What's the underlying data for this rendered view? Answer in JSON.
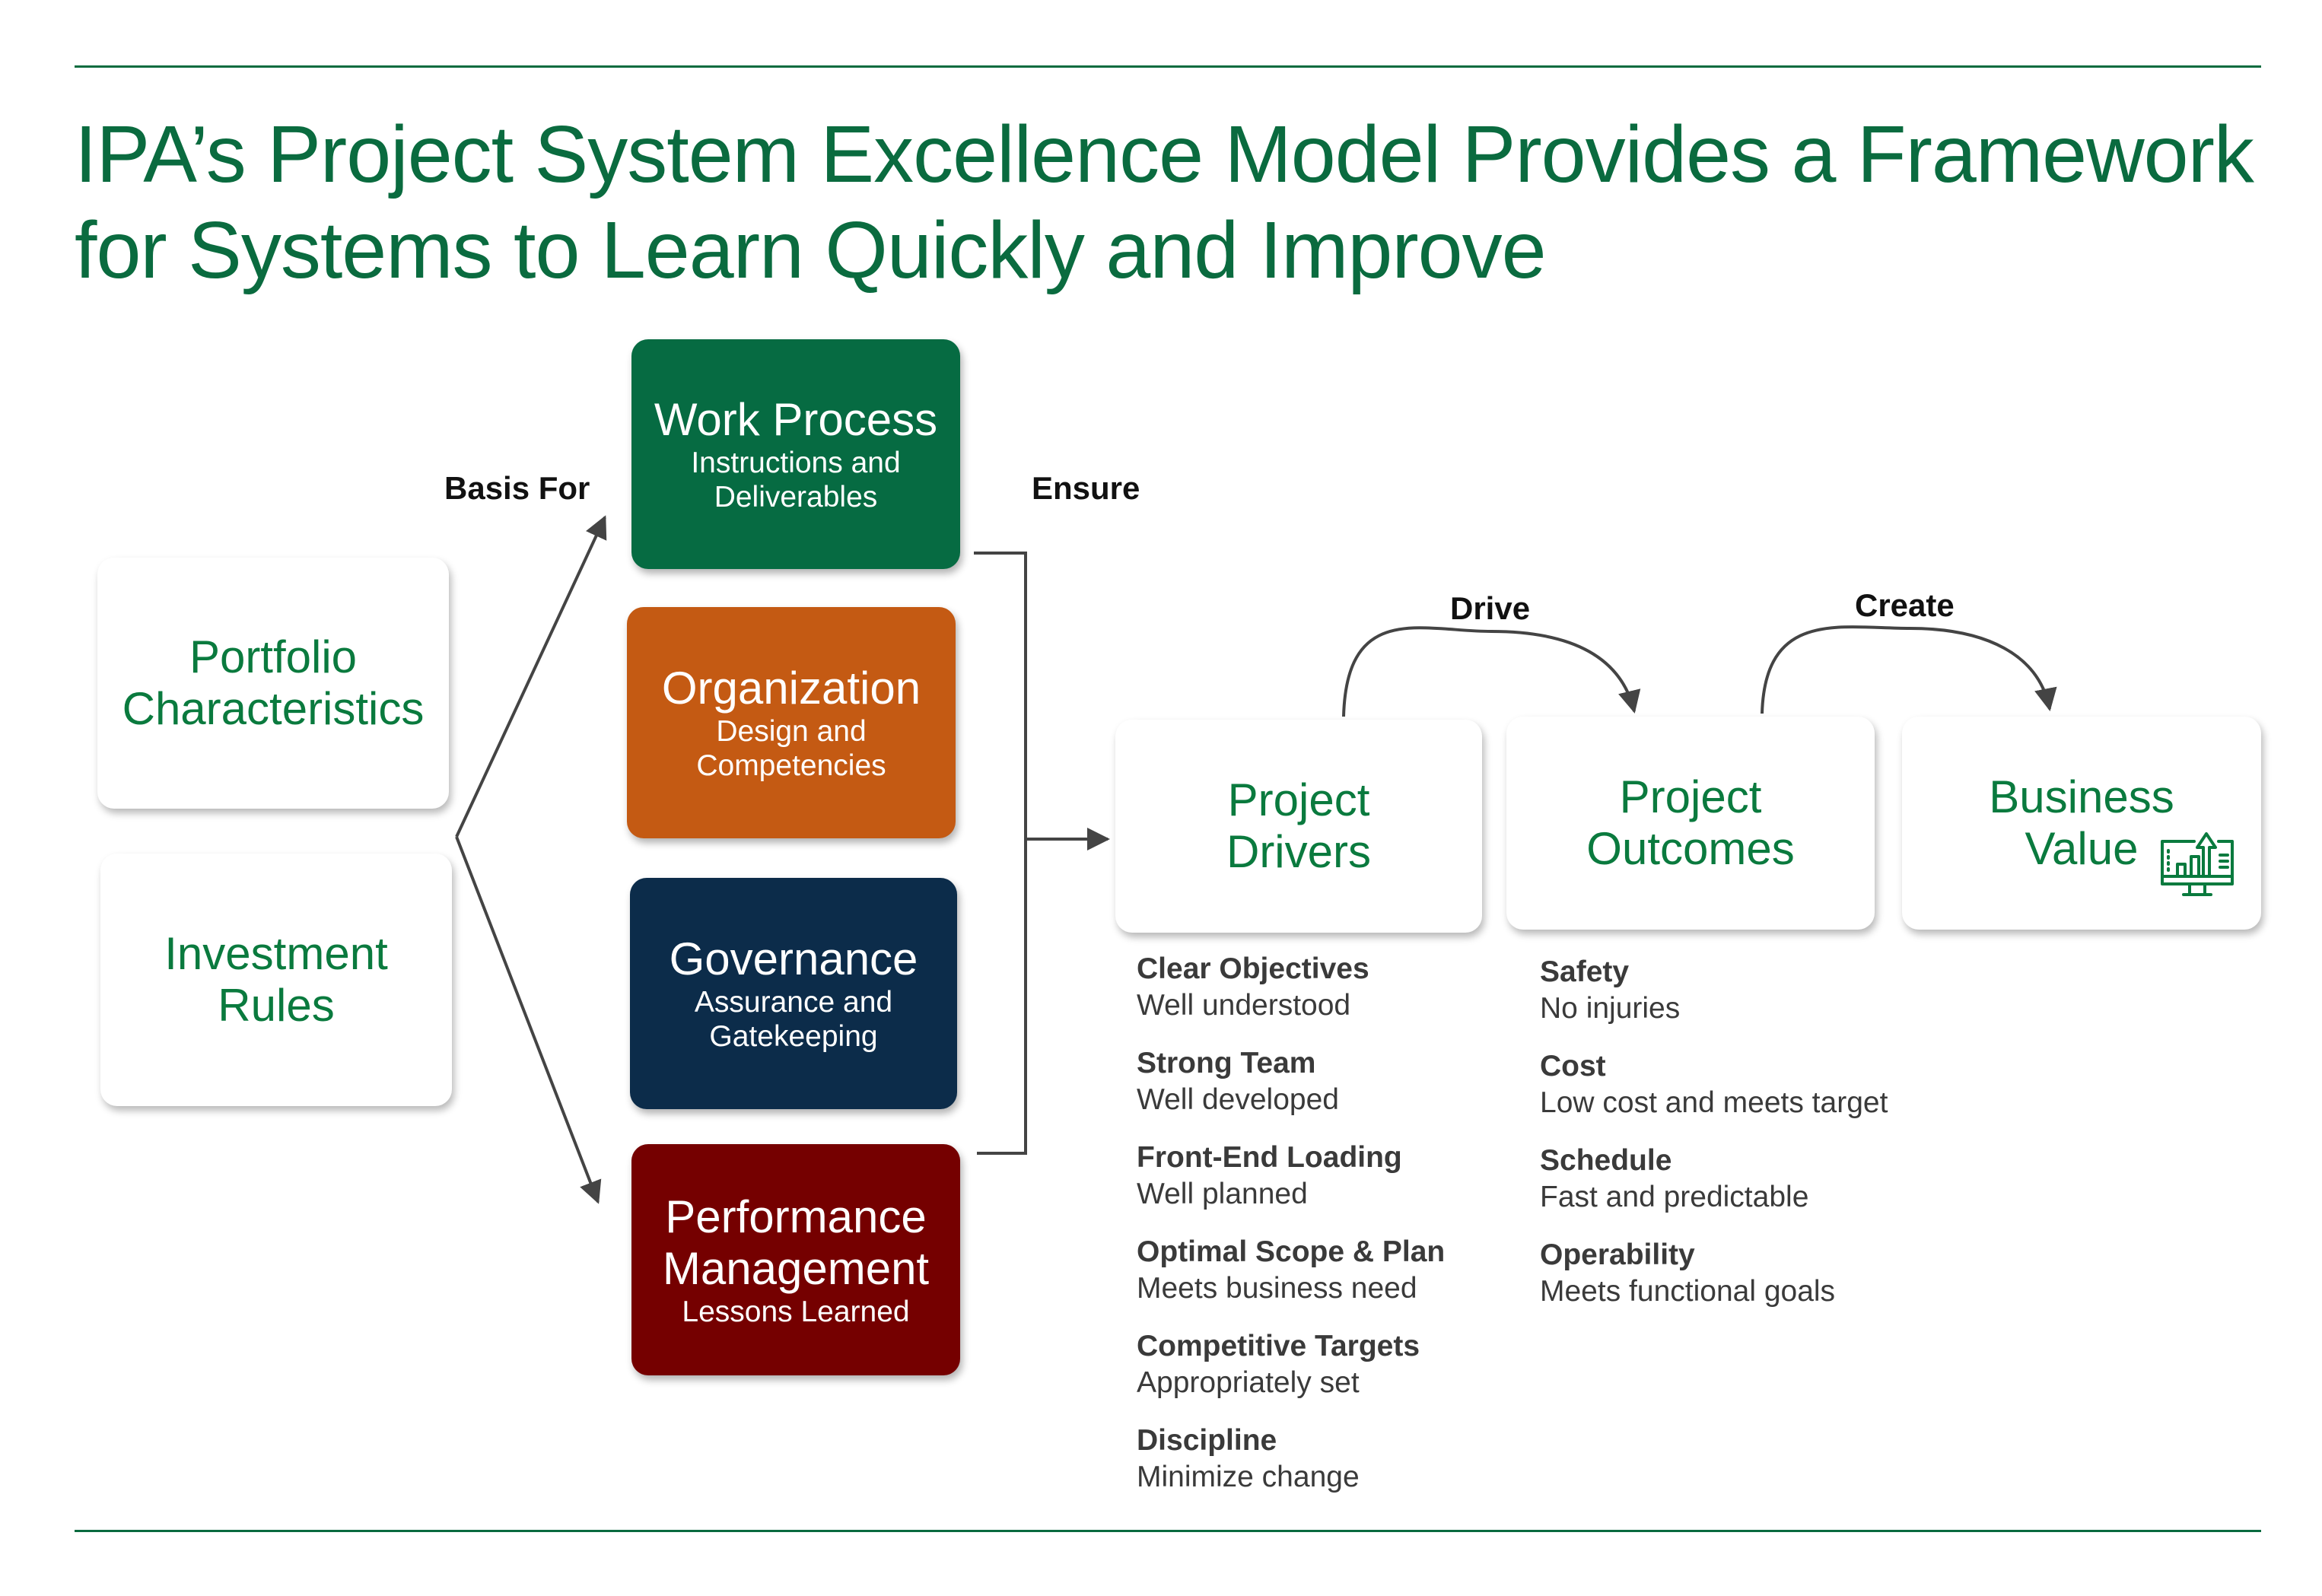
{
  "title": "IPA’s Project System Excellence Model Provides a Framework for Systems to Learn Quickly and Improve",
  "colors": {
    "brand_green": "#0a6b3f",
    "work_process": "#066b42",
    "organization": "#c45a13",
    "governance": "#0c2c4a",
    "performance": "#750000",
    "connector": "#444444"
  },
  "inputs": [
    {
      "label": "Portfolio Characteristics"
    },
    {
      "label": "Investment Rules"
    }
  ],
  "connector_labels": {
    "basis_for": "Basis For",
    "ensure": "Ensure",
    "drive": "Drive",
    "create": "Create"
  },
  "system_boxes": [
    {
      "title": "Work Process",
      "subtitle": "Instructions and Deliverables"
    },
    {
      "title": "Organization",
      "subtitle": "Design and Competencies"
    },
    {
      "title": "Governance",
      "subtitle": "Assurance and Gatekeeping"
    },
    {
      "title": "Performance Management",
      "subtitle": "Lessons Learned"
    }
  ],
  "stages": [
    {
      "label": "Project Drivers"
    },
    {
      "label": "Project Outcomes"
    },
    {
      "label": "Business Value",
      "icon": "chart-monitor-icon"
    }
  ],
  "drivers": [
    {
      "heading": "Clear Objectives",
      "detail": "Well understood"
    },
    {
      "heading": "Strong Team",
      "detail": "Well developed"
    },
    {
      "heading": "Front-End Loading",
      "detail": "Well planned"
    },
    {
      "heading": "Optimal Scope & Plan",
      "detail": "Meets business need"
    },
    {
      "heading": "Competitive Targets",
      "detail": "Appropriately set"
    },
    {
      "heading": "Discipline",
      "detail": "Minimize change"
    }
  ],
  "outcomes": [
    {
      "heading": "Safety",
      "detail": "No injuries"
    },
    {
      "heading": "Cost",
      "detail": "Low cost and meets target"
    },
    {
      "heading": "Schedule",
      "detail": "Fast and predictable"
    },
    {
      "heading": "Operability",
      "detail": "Meets functional goals"
    }
  ]
}
